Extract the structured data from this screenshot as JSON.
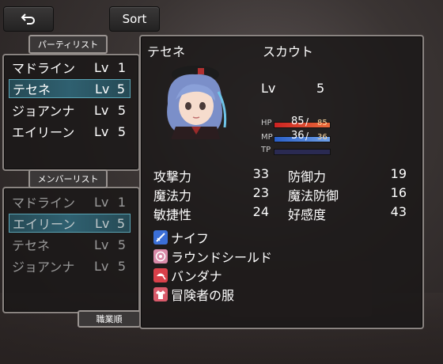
{
  "top": {
    "sort_label": "Sort"
  },
  "party": {
    "tag": "パーティリスト",
    "members": [
      {
        "name": "マドライン",
        "lv_label": "Lv",
        "lv": "1"
      },
      {
        "name": "テセネ",
        "lv_label": "Lv",
        "lv": "5"
      },
      {
        "name": "ジョアンナ",
        "lv_label": "Lv",
        "lv": "5"
      },
      {
        "name": "エイリーン",
        "lv_label": "Lv",
        "lv": "5"
      }
    ]
  },
  "members": {
    "tag": "メンバーリスト",
    "list": [
      {
        "name": "マドライン",
        "lv_label": "Lv",
        "lv": "1"
      },
      {
        "name": "エイリーン",
        "lv_label": "Lv",
        "lv": "5"
      },
      {
        "name": "テセネ",
        "lv_label": "Lv",
        "lv": "5"
      },
      {
        "name": "ジョアンナ",
        "lv_label": "Lv",
        "lv": "5"
      }
    ],
    "order_tag": "職業順"
  },
  "detail": {
    "name": "テセネ",
    "job": "スカウト",
    "lv_label": "Lv",
    "lv": "5",
    "hp_label": "HP",
    "hp": "85",
    "hp_max": "85",
    "hp_ratio": 1.0,
    "mp_label": "MP",
    "mp": "36",
    "mp_max": "36",
    "mp_ratio": 1.0,
    "tp_label": "TP",
    "tp_ratio": 0.0,
    "stats": [
      {
        "label": "攻撃力",
        "value": "33"
      },
      {
        "label": "防御力",
        "value": "19"
      },
      {
        "label": "魔法力",
        "value": "23"
      },
      {
        "label": "魔法防御",
        "value": "16"
      },
      {
        "label": "敏捷性",
        "value": "24"
      },
      {
        "label": "好感度",
        "value": "43"
      }
    ],
    "equipment": [
      {
        "icon": "sword-icon",
        "name": "ナイフ",
        "color": "#3b6fd6"
      },
      {
        "icon": "shield-icon",
        "name": "ラウンドシールド",
        "color": "#d98aa8"
      },
      {
        "icon": "bandana-icon",
        "name": "バンダナ",
        "color": "#d9404a"
      },
      {
        "icon": "clothes-icon",
        "name": "冒険者の服",
        "color": "#d95a6a"
      }
    ]
  },
  "colors": {
    "hp_bar": "#d83a3a",
    "mp_bar": "#3f7cd8",
    "selection": "#2f6070"
  }
}
